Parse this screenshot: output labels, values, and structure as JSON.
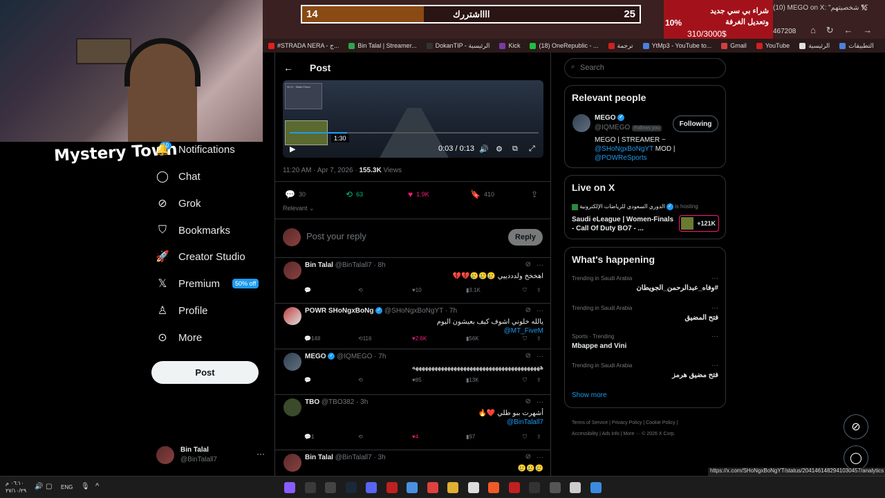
{
  "poll": {
    "left_value": "14",
    "label": "ااااشتررك",
    "right_value": "25",
    "fill": 0.36
  },
  "donation": {
    "percent": "10%",
    "title": "شراء بي سي جديد وتعديل الغرفة",
    "amount": "310/3000$"
  },
  "browser": {
    "tab_title": "(10) MEGO on X: \"؟؟ شخصيتهم",
    "address_stub": "467208"
  },
  "bookmarks": [
    "#STRADA NERA - ج...",
    "Bin Talal | Streamer...",
    "DokanTIP - الرئيسية",
    "Kick",
    "(18) OneRepublic - ...",
    "ترجمة",
    "YtMp3 - YouTube to...",
    "Gmail",
    "YouTube",
    "الرئيسية",
    "التطبيقات"
  ],
  "webcam": {
    "brand": "Mystery Town"
  },
  "nav": {
    "notif_badge": "10",
    "items": [
      {
        "label": "Notifications",
        "icon": "bell-icon"
      },
      {
        "label": "Chat",
        "icon": "chat-bubble-icon"
      },
      {
        "label": "Grok",
        "icon": "grok-icon"
      },
      {
        "label": "Bookmarks",
        "icon": "bookmark-icon"
      },
      {
        "label": "Creator Studio",
        "icon": "rocket-icon"
      },
      {
        "label": "Premium",
        "icon": "x-logo-icon",
        "badge": "50% off"
      },
      {
        "label": "Profile",
        "icon": "person-icon"
      },
      {
        "label": "More",
        "icon": "more-circle-icon"
      }
    ],
    "post_button": "Post",
    "account": {
      "name": "Bin Talal",
      "handle": "@BinTalall7"
    }
  },
  "post": {
    "header": "Post",
    "video": {
      "time": "0:03 / 0:13",
      "tooltip": "1:30",
      "progress": 0.23
    },
    "meta_time": "11:20 AM · Apr 7, 2026 · ",
    "views_count": "155.3K",
    "views_label": " Views",
    "actions": {
      "replies": "30",
      "reposts": "63",
      "likes": "1.9K",
      "bookmarks": "410"
    },
    "sort_label": "Relevant",
    "reply_placeholder": "Post your reply",
    "reply_button": "Reply"
  },
  "replies": [
    {
      "name": "Bin Talal",
      "handle": "@BinTalall7 · 8h",
      "text": "اهخخخ ولدددييي 🥲🥲🥲💔💔",
      "link": "",
      "stats": {
        "replies": "",
        "reposts": "",
        "likes": "10",
        "views": "3.1K"
      }
    },
    {
      "name": "POWR SHoNgxBoNg",
      "handle": "@SHoNgxBoNgYT · 7h",
      "text": "يالله خلوني اشوف كيف بعيشون اليوم",
      "link": "@MT_FiveM",
      "stats": {
        "replies": "148",
        "reposts": "116",
        "likes": "2.6K",
        "views": "56K"
      }
    },
    {
      "name": "MEGO",
      "handle": "@IQMEGO · 7h",
      "text": "ههههههههههههههههههههههههههههههههههههههههه",
      "link": "",
      "stats": {
        "replies": "",
        "reposts": "",
        "likes": "85",
        "views": "13K"
      }
    },
    {
      "name": "TBO",
      "handle": "@TBO382 · 3h",
      "text": "أشهرت ببو طلي ❤️🔥",
      "link": "@BinTalall7",
      "stats": {
        "replies": "1",
        "reposts": "",
        "likes": "4",
        "views": "97"
      }
    },
    {
      "name": "Bin Talal",
      "handle": "@BinTalall7 · 3h",
      "text": "🥲🥲🥲",
      "link": "",
      "stats": {
        "replies": "",
        "reposts": "",
        "likes": "",
        "views": ""
      }
    }
  ],
  "sidebar": {
    "search_placeholder": "Search",
    "relevant_title": "Relevant people",
    "person": {
      "name": "MEGO",
      "handle": "@IQMEGO",
      "follows_you": "Follows you",
      "button": "Following",
      "bio_1": "MEGO | STREAMER ~",
      "bio_link_1": "@SHoNgxBoNgYT",
      "bio_mid": " MOD |",
      "bio_link_2": "@POWReSports"
    },
    "live_title": "Live on X",
    "live": {
      "host": "الدوري السعودي للرياضات الإلكترونية",
      "hosting": "is hosting",
      "title": "Saudi eLeague | Women-Finals - Call Of Duty BO7 - ...",
      "count": "+121K"
    },
    "happening_title": "What's happening",
    "trends": [
      {
        "label": "Trending in Saudi Arabia",
        "name": "#وفاه_عبدالرحمن_الجويطان"
      },
      {
        "label": "Trending in Saudi Arabia",
        "name": "فتح المضيق"
      },
      {
        "label": "Sports · Trending",
        "name": "Mbappe and Vini"
      },
      {
        "label": "Trending in Saudi Arabia",
        "name": "فتح مضيق هرمز"
      }
    ],
    "show_more": "Show more",
    "footer_1": "Terms of Service  |  Privacy Policy  |  Cookie Policy  |",
    "footer_2": "Accessibility  |  Ads info  |  More ···  © 2026 X Corp."
  },
  "status_url": "https://x.com/SHoNgxBoNgYT/status/2041461482941030457/analytics",
  "taskbar": {
    "time": "٠٦:١٠ م",
    "date": "٢٧/١٠/٢٩",
    "lang": "ENG"
  },
  "colors": {
    "accent": "#1d9bf0",
    "like": "#f91880",
    "repost": "#00ba7c",
    "bg": "#000000"
  }
}
